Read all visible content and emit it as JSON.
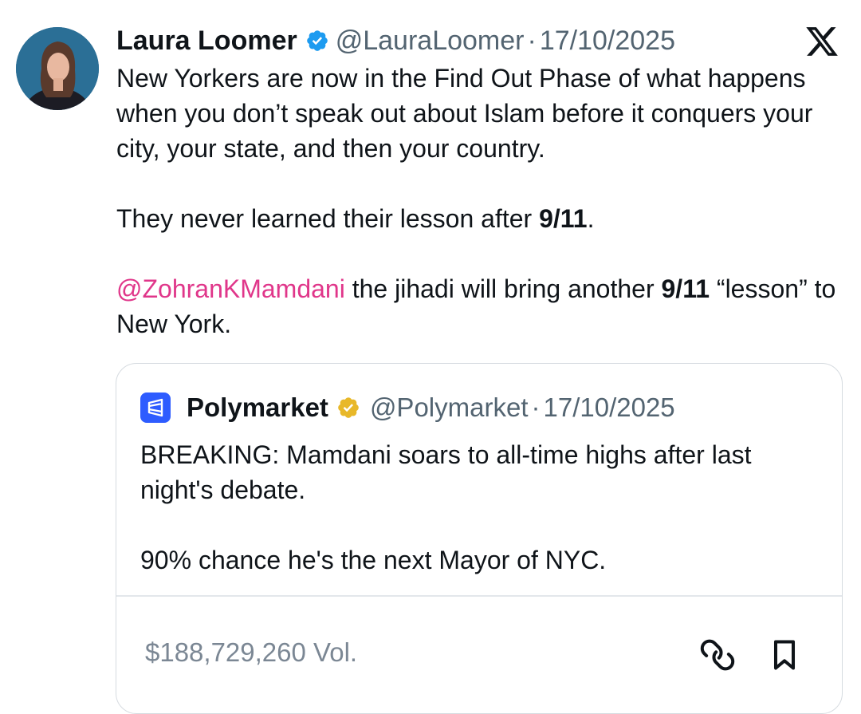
{
  "tweet": {
    "author_name": "Laura Loomer",
    "handle": "@LauraLoomer",
    "date_sep": "·",
    "date": "17/10/2025",
    "text_p1": "New Yorkers are now in the Find Out Phase of what happens when you don’t speak out about Islam before it conquers your city, your state, and then your country.",
    "text_p2_before": "They never learned their lesson after ",
    "text_p2_bold": "9/11",
    "text_p2_after": ".",
    "mention": "@ZohranKMamdani",
    "text_p3_mid": " the jihadi will bring another ",
    "text_p3_bold": "9/11",
    "text_p3_after": " “lesson” to New York."
  },
  "quote": {
    "author_name": "Polymarket",
    "handle": "@Polymarket",
    "date_sep": "·",
    "date": "17/10/2025",
    "text_p1": "BREAKING: Mamdani soars to all-time highs after last night's debate.",
    "text_p2": "90% chance he's the next Mayor of NYC.",
    "volume": "$188,729,260 Vol."
  },
  "icons": {
    "verified": "blue-verified-badge-icon",
    "gold_verified": "gold-verified-badge-icon",
    "platform": "x-logo-icon",
    "quote_logo": "polymarket-logo-icon",
    "link": "link-icon",
    "bookmark": "bookmark-icon"
  },
  "colors": {
    "mention": "#e0368a",
    "verified_blue": "#1d9bf0",
    "gold": "#e8b829",
    "polymarket_blue": "#2e5cff",
    "muted": "#536471"
  }
}
